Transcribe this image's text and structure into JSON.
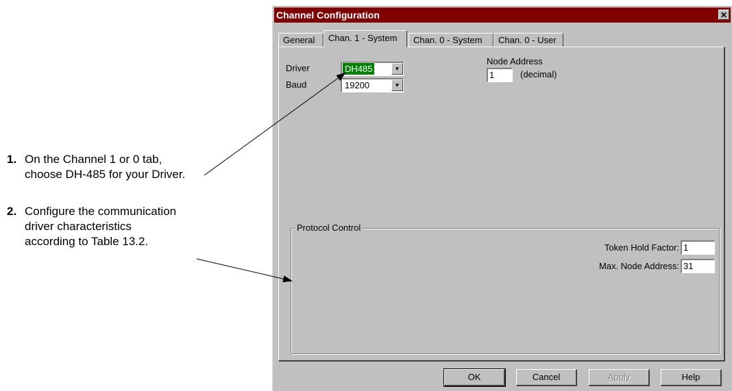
{
  "callouts": [
    {
      "number": "1.",
      "lines": [
        "On the Channel 1 or 0 tab,",
        "choose DH-485 for your Driver."
      ]
    },
    {
      "number": "2.",
      "lines": [
        "Configure the communication",
        "driver characteristics",
        "according to Table 13.2."
      ]
    }
  ],
  "dialog": {
    "title": "Channel Configuration",
    "close_glyph": "✕",
    "tabs": [
      {
        "label": "General",
        "active": false
      },
      {
        "label": "Chan. 1 - System",
        "active": true
      },
      {
        "label": "Chan. 0 - System",
        "active": false
      },
      {
        "label": "Chan. 0 - User",
        "active": false
      }
    ],
    "driver": {
      "label": "Driver",
      "value": "DH485"
    },
    "baud": {
      "label": "Baud",
      "value": "19200"
    },
    "node_address": {
      "label": "Node Address",
      "value": "1",
      "unit": "(decimal)"
    },
    "protocol_control": {
      "legend": "Protocol Control",
      "token_hold_factor": {
        "label": "Token Hold Factor:",
        "value": "1"
      },
      "max_node_address": {
        "label": "Max. Node Address:",
        "value": "31"
      }
    },
    "buttons": {
      "ok": "OK",
      "cancel": "Cancel",
      "apply": "Apply",
      "help": "Help"
    }
  }
}
